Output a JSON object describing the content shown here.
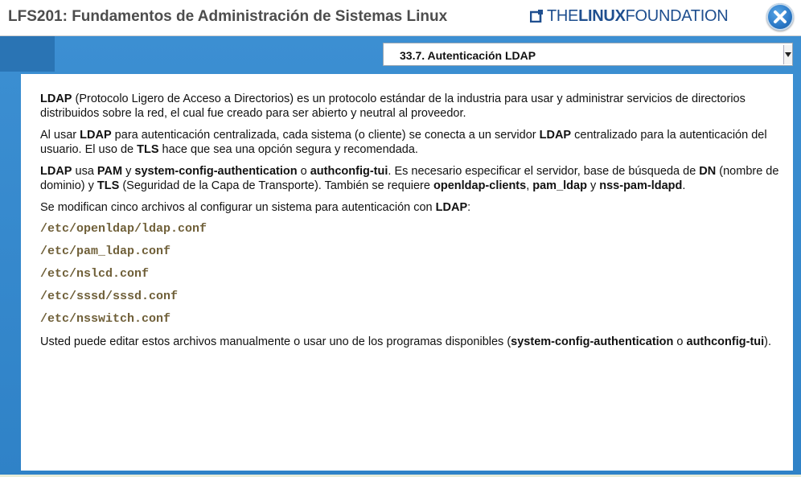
{
  "header": {
    "course_title": "LFS201: Fundamentos de Administración de Sistemas Linux",
    "brand": {
      "the": "THE",
      "linux": "LINUX",
      "foundation": "FOUNDATION",
      "icon": "linux-foundation-logo-icon"
    },
    "close_icon": "close-icon"
  },
  "colors": {
    "brand": "#1f4f8f",
    "stage_blue": "#2f82c7",
    "close_button": "#2a78c6",
    "file_path": "#6f5f38"
  },
  "section_select": {
    "selected": "33.7. Autenticación LDAP"
  },
  "content": {
    "p1": [
      {
        "t": "LDAP",
        "b": true
      },
      {
        "t": " (Protocolo Ligero de Acceso a Directorios) es un protocolo estándar de la industria para usar y administrar servicios de directorios distribuidos sobre la red, el cual fue creado para ser abierto y neutral al proveedor.",
        "b": false
      }
    ],
    "p2": [
      {
        "t": "Al usar ",
        "b": false
      },
      {
        "t": "LDAP",
        "b": true
      },
      {
        "t": " para autenticación centralizada, cada sistema (o cliente) se conecta a un servidor ",
        "b": false
      },
      {
        "t": "LDAP",
        "b": true
      },
      {
        "t": " centralizado para la autenticación del usuario. El uso de ",
        "b": false
      },
      {
        "t": "TLS",
        "b": true
      },
      {
        "t": " hace que sea una opción segura y recomendada.",
        "b": false
      }
    ],
    "p3": [
      {
        "t": "LDAP",
        "b": true
      },
      {
        "t": " usa ",
        "b": false
      },
      {
        "t": "PAM",
        "b": true
      },
      {
        "t": " y ",
        "b": false
      },
      {
        "t": "system-config-authentication",
        "b": true
      },
      {
        "t": " o ",
        "b": false
      },
      {
        "t": "authconfig-tui",
        "b": true
      },
      {
        "t": ". Es necesario especificar el servidor, base de búsqueda de ",
        "b": false
      },
      {
        "t": "DN",
        "b": true
      },
      {
        "t": " (nombre de dominio) y ",
        "b": false
      },
      {
        "t": "TLS",
        "b": true
      },
      {
        "t": " (Seguridad de la Capa de Transporte). También se requiere ",
        "b": false
      },
      {
        "t": "openldap-clients",
        "b": true
      },
      {
        "t": ", ",
        "b": false
      },
      {
        "t": "pam_ldap",
        "b": true
      },
      {
        "t": " y ",
        "b": false
      },
      {
        "t": "nss-pam-ldapd",
        "b": true
      },
      {
        "t": ".",
        "b": false
      }
    ],
    "p4": [
      {
        "t": "Se modifican cinco archivos al configurar un sistema para autenticación con ",
        "b": false
      },
      {
        "t": "LDAP",
        "b": true
      },
      {
        "t": ":",
        "b": false
      }
    ],
    "files": [
      "/etc/openldap/ldap.conf",
      "/etc/pam_ldap.conf",
      "/etc/nslcd.conf",
      "/etc/sssd/sssd.conf",
      "/etc/nsswitch.conf"
    ],
    "p5": [
      {
        "t": "Usted puede editar estos archivos manualmente o usar uno de los programas disponibles (",
        "b": false
      },
      {
        "t": "system-config-authentication",
        "b": true
      },
      {
        "t": " o ",
        "b": false
      },
      {
        "t": "authconfig-tui",
        "b": true
      },
      {
        "t": ").",
        "b": false
      }
    ]
  }
}
